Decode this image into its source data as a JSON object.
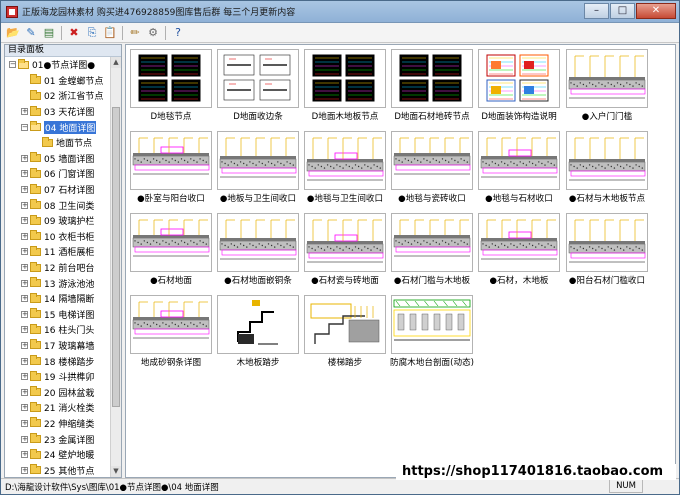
{
  "window": {
    "title": "正版海龙园林素材 购买进476928859图库售后群 每三个月更新内容"
  },
  "title_buttons": {
    "minimize": "–",
    "maximize": "□",
    "close": "✕"
  },
  "toolbar": {
    "items": [
      {
        "name": "open-folder-icon",
        "glyph": "📂"
      },
      {
        "name": "edit-icon",
        "glyph": "✎"
      },
      {
        "name": "list-icon",
        "glyph": "▤"
      },
      {
        "name": "delete-icon",
        "glyph": "✖"
      },
      {
        "name": "copy-icon",
        "glyph": "⎘"
      },
      {
        "name": "paste-icon",
        "glyph": "📋"
      },
      {
        "name": "pen-icon",
        "glyph": "✏"
      },
      {
        "name": "tool-icon",
        "glyph": "⚙"
      },
      {
        "name": "help-icon",
        "glyph": "?"
      }
    ]
  },
  "sidebar": {
    "heading": "目录面板",
    "items": [
      {
        "label": "01●节点详图●",
        "level": 0,
        "expander": "−",
        "open": true
      },
      {
        "label": "01 金螳螂节点",
        "level": 1,
        "expander": "",
        "open": false
      },
      {
        "label": "02 浙江省节点",
        "level": 1,
        "expander": "",
        "open": false
      },
      {
        "label": "03 天花详图",
        "level": 1,
        "expander": "+",
        "open": false
      },
      {
        "label": "04 地面详图",
        "level": 1,
        "expander": "−",
        "open": true,
        "selected": true
      },
      {
        "label": "地面节点",
        "level": 2,
        "expander": "",
        "open": false
      },
      {
        "label": "05 墙面详图",
        "level": 1,
        "expander": "+",
        "open": false
      },
      {
        "label": "06 门窗详图",
        "level": 1,
        "expander": "+",
        "open": false
      },
      {
        "label": "07 石材详图",
        "level": 1,
        "expander": "+",
        "open": false
      },
      {
        "label": "08 卫生间类",
        "level": 1,
        "expander": "+",
        "open": false
      },
      {
        "label": "09 玻璃护栏",
        "level": 1,
        "expander": "+",
        "open": false
      },
      {
        "label": "10 衣柜书柜",
        "level": 1,
        "expander": "+",
        "open": false
      },
      {
        "label": "11 酒柜展柜",
        "level": 1,
        "expander": "+",
        "open": false
      },
      {
        "label": "12 前台吧台",
        "level": 1,
        "expander": "+",
        "open": false
      },
      {
        "label": "13 游泳池池",
        "level": 1,
        "expander": "+",
        "open": false
      },
      {
        "label": "14 隔墙隔断",
        "level": 1,
        "expander": "+",
        "open": false
      },
      {
        "label": "15 电梯详图",
        "level": 1,
        "expander": "+",
        "open": false
      },
      {
        "label": "16 柱头门头",
        "level": 1,
        "expander": "+",
        "open": false
      },
      {
        "label": "17 玻璃幕墙",
        "level": 1,
        "expander": "+",
        "open": false
      },
      {
        "label": "18 楼梯踏步",
        "level": 1,
        "expander": "+",
        "open": false
      },
      {
        "label": "19 斗拱榫卯",
        "level": 1,
        "expander": "+",
        "open": false
      },
      {
        "label": "20 园林盆栽",
        "level": 1,
        "expander": "+",
        "open": false
      },
      {
        "label": "21 消火栓类",
        "level": 1,
        "expander": "+",
        "open": false
      },
      {
        "label": "22 伸缩缝类",
        "level": 1,
        "expander": "+",
        "open": false
      },
      {
        "label": "23 金属详图",
        "level": 1,
        "expander": "+",
        "open": false
      },
      {
        "label": "24 壁炉地暖",
        "level": 1,
        "expander": "+",
        "open": false
      },
      {
        "label": "25 其他节点",
        "level": 1,
        "expander": "+",
        "open": false
      }
    ]
  },
  "thumbnails": [
    {
      "label": "D地毯节点",
      "style": "black"
    },
    {
      "label": "D地面收边条",
      "style": "white"
    },
    {
      "label": "D地面木地板节点",
      "style": "black"
    },
    {
      "label": "D地面石材地砖节点",
      "style": "black"
    },
    {
      "label": "D地面装饰构造说明",
      "style": "color"
    },
    {
      "label": "●入户门门槛",
      "style": "section"
    },
    {
      "label": "●卧室与阳台收口",
      "style": "section"
    },
    {
      "label": "●地板与卫生间收口",
      "style": "section"
    },
    {
      "label": "●地毯与卫生间收口",
      "style": "section"
    },
    {
      "label": "●地毯与瓷砖收口",
      "style": "section"
    },
    {
      "label": "●地毯与石材收口",
      "style": "section"
    },
    {
      "label": "●石材与木地板节点",
      "style": "section"
    },
    {
      "label": "●石材地面",
      "style": "section"
    },
    {
      "label": "●石材地面嵌铜条",
      "style": "section"
    },
    {
      "label": "●石材瓷与砖地面",
      "style": "section"
    },
    {
      "label": "●石材门槛与木地板",
      "style": "section"
    },
    {
      "label": "●石材，木地板",
      "style": "section"
    },
    {
      "label": "●阳台石材门槛收口",
      "style": "section"
    },
    {
      "label": "地成砂钢条详图",
      "style": "section"
    },
    {
      "label": "木地板踏步",
      "style": "stair"
    },
    {
      "label": "楼梯踏步",
      "style": "stair2"
    },
    {
      "label": "防腐木地台剖面(动态)",
      "style": "wood"
    }
  ],
  "status": {
    "path": "D:\\海龍设计软件\\Sys\\图库\\01●节点详图●\\04 地面详图",
    "num": "NUM",
    "watermark": "https://shop117401816.taobao.com"
  }
}
